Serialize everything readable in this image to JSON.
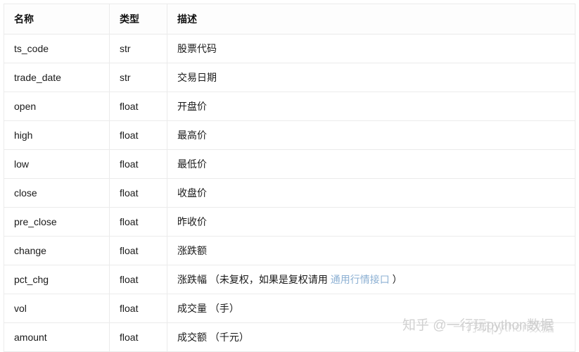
{
  "table": {
    "columns": [
      {
        "key": "name",
        "label": "名称"
      },
      {
        "key": "type",
        "label": "类型"
      },
      {
        "key": "desc",
        "label": "描述"
      }
    ],
    "rows": [
      {
        "name": "ts_code",
        "type": "str",
        "desc_pre": "股票代码",
        "desc_link": "",
        "desc_post": ""
      },
      {
        "name": "trade_date",
        "type": "str",
        "desc_pre": "交易日期",
        "desc_link": "",
        "desc_post": ""
      },
      {
        "name": "open",
        "type": "float",
        "desc_pre": "开盘价",
        "desc_link": "",
        "desc_post": ""
      },
      {
        "name": "high",
        "type": "float",
        "desc_pre": "最高价",
        "desc_link": "",
        "desc_post": ""
      },
      {
        "name": "low",
        "type": "float",
        "desc_pre": "最低价",
        "desc_link": "",
        "desc_post": ""
      },
      {
        "name": "close",
        "type": "float",
        "desc_pre": "收盘价",
        "desc_link": "",
        "desc_post": ""
      },
      {
        "name": "pre_close",
        "type": "float",
        "desc_pre": "昨收价",
        "desc_link": "",
        "desc_post": ""
      },
      {
        "name": "change",
        "type": "float",
        "desc_pre": "涨跌额",
        "desc_link": "",
        "desc_post": ""
      },
      {
        "name": "pct_chg",
        "type": "float",
        "desc_pre": "涨跌幅 （未复权，如果是复权请用 ",
        "desc_link": "通用行情接口",
        "desc_post": " ）"
      },
      {
        "name": "vol",
        "type": "float",
        "desc_pre": "成交量 （手）",
        "desc_link": "",
        "desc_post": ""
      },
      {
        "name": "amount",
        "type": "float",
        "desc_pre": "成交额 （千元）",
        "desc_link": "",
        "desc_post": ""
      }
    ]
  },
  "watermark": {
    "line_a": "知乎 @一行玩python数据",
    "line_b": "一行玩python数据"
  },
  "colors": {
    "link": "#8cb0d3",
    "border": "#ebebeb",
    "text": "#1a1a1a",
    "watermark": "#c9c9c9"
  }
}
